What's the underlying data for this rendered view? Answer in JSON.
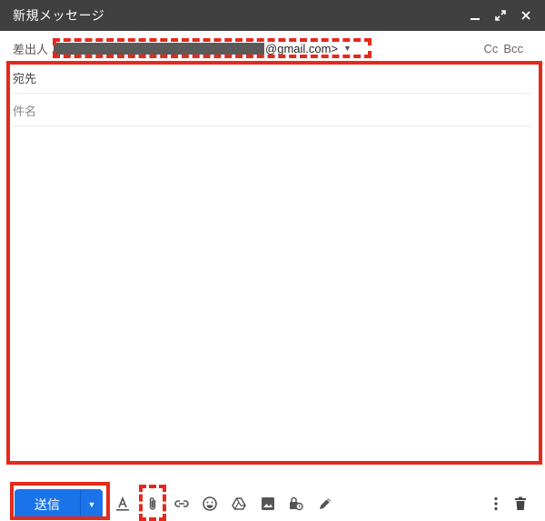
{
  "window": {
    "title": "新規メッセージ",
    "controls": {
      "minimize": "minimize-icon",
      "expand": "expand-icon",
      "close": "close-icon"
    }
  },
  "from": {
    "label": "差出人",
    "email_domain_visible": "@gmail.com>",
    "caret": "▼"
  },
  "recipients": {
    "cc": "Cc",
    "bcc": "Bcc"
  },
  "fields": {
    "to_label": "宛先",
    "subject_placeholder": "件名"
  },
  "toolbar": {
    "send_label": "送信",
    "send_caret": "▼",
    "icons": [
      "format-text-icon",
      "attach-icon",
      "link-icon",
      "emoji-icon",
      "drive-icon",
      "photo-icon",
      "confidential-icon",
      "signature-icon",
      "more-options-icon",
      "trash-icon"
    ]
  },
  "colors": {
    "titlebar_bg": "#404040",
    "send_button": "#1a73e8",
    "annotation_red": "#e5291a"
  }
}
